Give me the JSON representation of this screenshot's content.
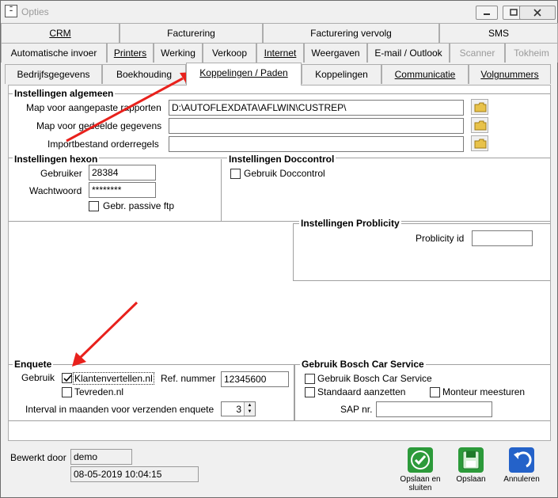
{
  "window": {
    "title": "Opties"
  },
  "tabs": {
    "row1": [
      "CRM",
      "Facturering",
      "Facturering vervolg",
      "SMS"
    ],
    "row2": [
      "Automatische invoer",
      "Printers",
      "Werking",
      "Verkoop",
      "Internet",
      "Weergaven",
      "E-mail / Outlook",
      "Scanner",
      "Tokheim"
    ],
    "row3": [
      "Bedrijfsgegevens",
      "Boekhouding",
      "Koppelingen / Paden",
      "Koppelingen",
      "Communicatie",
      "Volgnummers"
    ]
  },
  "algemeen": {
    "title": "Instellingen algemeen",
    "rapporten_label": "Map voor aangepaste rapporten",
    "rapporten_value": "D:\\AUTOFLEXDATA\\AFLWIN\\CUSTREP\\",
    "gedeeld_label": "Map voor gedeelde gegevens",
    "gedeeld_value": "",
    "import_label": "Importbestand orderregels",
    "import_value": ""
  },
  "hexon": {
    "title": "Instellingen hexon",
    "gebruiker_label": "Gebruiker",
    "gebruiker_value": "28384",
    "wachtwoord_label": "Wachtwoord",
    "wachtwoord_value": "********",
    "passive_label": "Gebr. passive ftp",
    "passive_checked": false
  },
  "doccontrol": {
    "title": "Instellingen Doccontrol",
    "gebruik_label": "Gebruik Doccontrol",
    "gebruik_checked": false
  },
  "problicity": {
    "title": "Instellingen Problicity",
    "id_label": "Problicity id",
    "id_value": ""
  },
  "enquete": {
    "title": "Enquete",
    "gebruik_label": "Gebruik",
    "klanten_label": "Klantenvertellen.nl",
    "klanten_checked": true,
    "tevreden_label": "Tevreden.nl",
    "tevreden_checked": false,
    "ref_label": "Ref. nummer",
    "ref_value": "12345600",
    "interval_label": "Interval in maanden voor verzenden enquete",
    "interval_value": "3"
  },
  "bosch": {
    "title": "Gebruik Bosch Car Service",
    "gebruik_label": "Gebruik Bosch Car Service",
    "standaard_label": "Standaard aanzetten",
    "monteur_label": "Monteur meesturen",
    "sap_label": "SAP nr.",
    "sap_value": ""
  },
  "footer": {
    "bewerkt_label": "Bewerkt door",
    "bewerkt_value": "demo",
    "datum_value": "08-05-2019 10:04:15",
    "opslaan_sluiten": "Opslaan en sluiten",
    "opslaan": "Opslaan",
    "annuleren": "Annuleren"
  },
  "colors": {
    "arrow": "#e8211c",
    "save_green": "#2c9a3a",
    "cancel_blue": "#2462c9"
  }
}
